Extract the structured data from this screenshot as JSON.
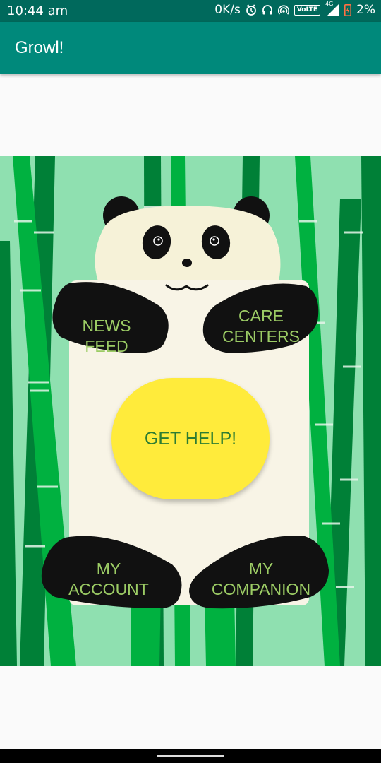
{
  "status_bar": {
    "time": "10:44 am",
    "network_speed": "0K/s",
    "volte": "VoLTE",
    "network_type": "4G",
    "battery_percent": "2%",
    "icons": [
      "alarm-icon",
      "headset-icon",
      "hotspot-icon",
      "volte-icon",
      "signal-icon",
      "battery-icon"
    ]
  },
  "app_bar": {
    "title": "Growl!"
  },
  "menu": {
    "news_feed": "NEWS FEED",
    "care_centers": "CARE\nCENTERS",
    "get_help": "GET HELP!",
    "my_account": "MY\nACCOUNT",
    "my_companion": "MY\nCOMPANION"
  },
  "colors": {
    "status_bar": "#00695c",
    "app_bar": "#00897b",
    "scene_background": "#8fe0b0",
    "bamboo_light": "#00b140",
    "bamboo_dark": "#008037",
    "panda_body": "#f8f4e6",
    "paw": "#111111",
    "paw_text": "#9ccc65",
    "help_button": "#ffeb3b",
    "help_text": "#2e7d32"
  }
}
